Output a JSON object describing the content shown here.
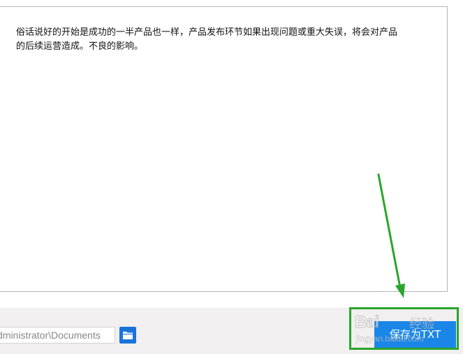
{
  "editor": {
    "content": "俗话说好的开始是成功的一半产品也一样，产品发布环节如果出现问题或重大失误，将会对产品\n的后续运营造成。不良的影响。"
  },
  "footer": {
    "path_value": "dministrator\\Documents",
    "save_label": "保存为TXT"
  },
  "icons": {
    "folder": "folder-icon",
    "arrow": "annotation-arrow-icon"
  },
  "watermark": {
    "brand": "Bai",
    "cn": "经验",
    "url": "jingyan.baidu.com"
  },
  "colors": {
    "accent_blue": "#1a86e8",
    "folder_blue": "#1a73d9",
    "annotation_green": "#2aa52a",
    "footer_bg": "#f1efef"
  }
}
